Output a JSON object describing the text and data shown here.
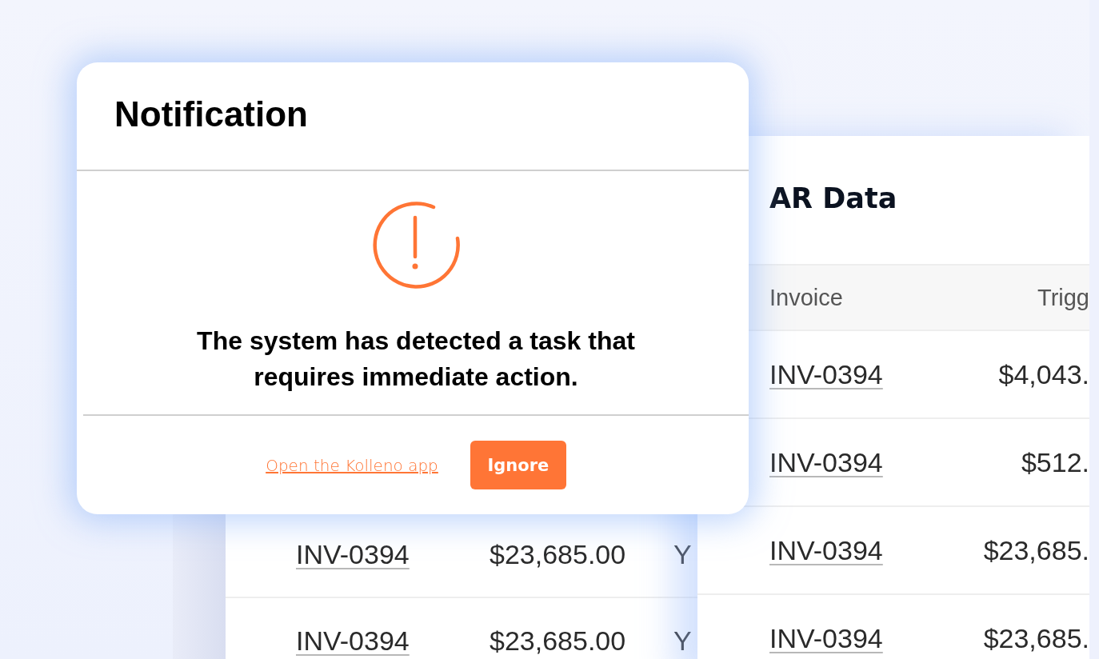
{
  "back_table": {
    "rows": [
      {
        "invoice": "INV-0394",
        "amount": "$23,685.00",
        "column_3": "Y"
      },
      {
        "invoice": "INV-0394",
        "amount": "$23,685.00",
        "column_3": "Y"
      }
    ]
  },
  "ar_data": {
    "title": "AR Data",
    "columns": [
      "Invoice",
      "Trigg"
    ],
    "rows": [
      {
        "invoice": "INV-0394",
        "column_2": "$4,043."
      },
      {
        "invoice": "INV-0394",
        "column_2": "$512."
      },
      {
        "invoice": "INV-0394",
        "column_2": "$23,685."
      },
      {
        "invoice": "INV-0394",
        "column_2": "$23,685."
      }
    ]
  },
  "dialog": {
    "title": "Notification",
    "message": "The system has detected a task that requires immediate action.",
    "link": "Open the Kolleno app",
    "button": "Ignore"
  }
}
